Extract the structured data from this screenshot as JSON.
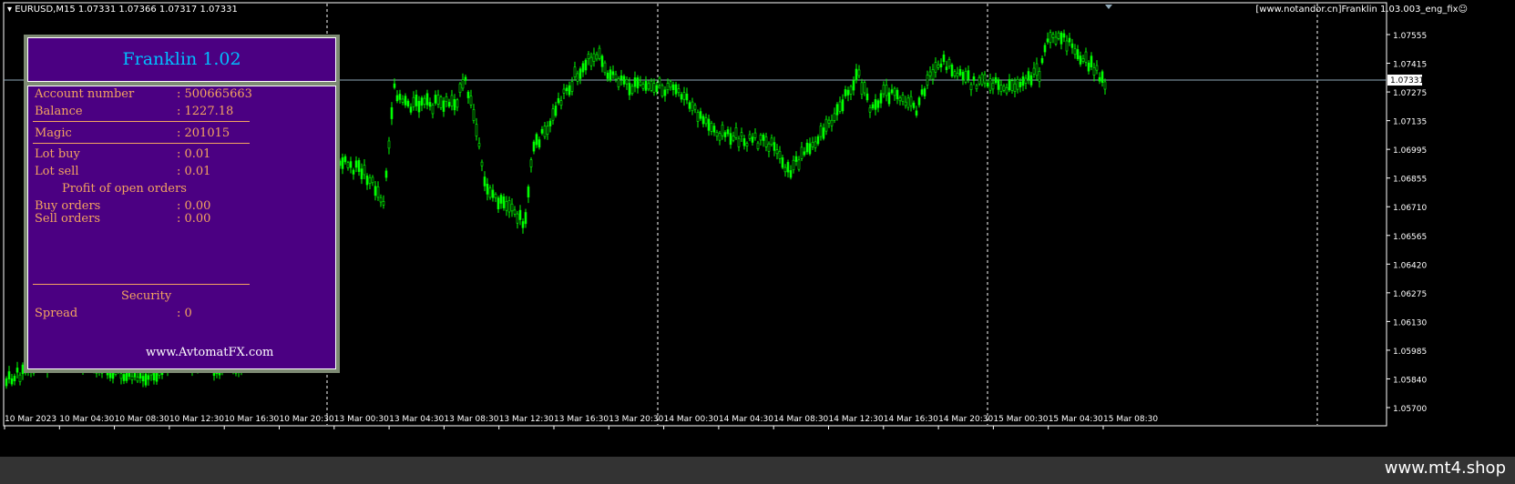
{
  "chart_header": {
    "symbol_line": "▾ EURUSD,M15  1.07331 1.07366 1.07317 1.07331",
    "ea_label": "[www.notandor.cn]Franklin 1.03.003_eng_fix☺"
  },
  "panel": {
    "title": "Franklin 1.02",
    "rows": [
      {
        "label": "Account number",
        "value": ": 500665663"
      },
      {
        "label": "Balance",
        "value": ": 1227.18"
      },
      {
        "label": "Magic",
        "value": ": 201015"
      },
      {
        "label": "Lot buy",
        "value": ": 0.01"
      },
      {
        "label": "Lot sell",
        "value": ": 0.01"
      }
    ],
    "profit_heading": "Profit of open orders",
    "profit_rows": [
      {
        "label": "Buy orders",
        "value": ": 0.00"
      },
      {
        "label": "Sell orders",
        "value": ": 0.00"
      }
    ],
    "security_heading": "Security",
    "spread_label": "Spread",
    "spread_value": ": 0",
    "website": "www.AvtomatFX.com"
  },
  "price_axis": [
    "1.07555",
    "1.07415",
    "1.07275",
    "1.07135",
    "1.06995",
    "1.06855",
    "1.06710",
    "1.06565",
    "1.06420",
    "1.06275",
    "1.06130",
    "1.05985",
    "1.05840",
    "1.05700"
  ],
  "current_price": "1.07331",
  "time_axis": [
    "10 Mar 2023",
    "10 Mar 04:30",
    "10 Mar 08:30",
    "10 Mar 12:30",
    "10 Mar 16:30",
    "10 Mar 20:30",
    "13 Mar 00:30",
    "13 Mar 04:30",
    "13 Mar 08:30",
    "13 Mar 12:30",
    "13 Mar 16:30",
    "13 Mar 20:30",
    "14 Mar 00:30",
    "14 Mar 04:30",
    "14 Mar 08:30",
    "14 Mar 12:30",
    "14 Mar 16:30",
    "14 Mar 20:30",
    "15 Mar 00:30",
    "15 Mar 04:30",
    "15 Mar 08:30"
  ],
  "colors": {
    "candles": "#00ff00",
    "panel_bg": "#4b0082",
    "panel_text": "#f4a460",
    "title_text": "#00bfff",
    "price_line": "#8fa8b8"
  },
  "watermark": "www.mt4.shop"
}
